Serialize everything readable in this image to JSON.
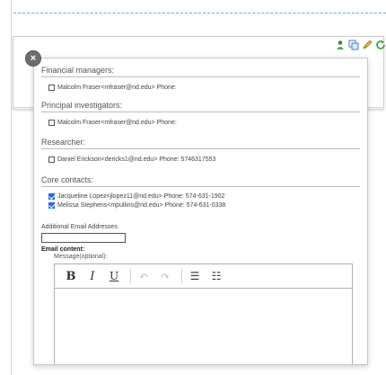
{
  "toolbar_icons": [
    "person-icon",
    "copy-icon",
    "pen-icon",
    "refresh-icon"
  ],
  "dialog": {
    "close_label": "×",
    "sections": {
      "financial": {
        "heading": "Financial managers:",
        "contacts": [
          {
            "text": "Malcolm Fraser<mfraser@nd.edu> Phone:",
            "checked": false
          }
        ]
      },
      "principal": {
        "heading": "Principal investigators:",
        "contacts": [
          {
            "text": "Malcolm Fraser<mfraser@nd.edu> Phone:",
            "checked": false
          }
        ]
      },
      "researcher": {
        "heading": "Researcher:",
        "contacts": [
          {
            "text": "Daniel Erickson<dericks1@nd.edu> Phone: 5746317553",
            "checked": false
          }
        ]
      },
      "core": {
        "heading": "Core contacts:",
        "contacts": [
          {
            "text": "Jacqueline Lopez<jlopez11@nd.edu> Phone: 574-631-1902",
            "checked": true
          },
          {
            "text": "Melissa Stephens<mpullins@nd.edu> Phone: 574-631-0338",
            "checked": true
          }
        ]
      }
    },
    "additional_emails_label": "Additional Email Addresses",
    "additional_emails_value": "",
    "email_content_label": "Email content:",
    "message_label": "Message(optional):",
    "editor_toolbar": {
      "bold": "B",
      "italic": "I",
      "underline": "U",
      "undo": "↶",
      "redo": "↷",
      "bullet_list": "☰",
      "numbered_list": "☷"
    },
    "accent_color": "#2d6bd6"
  }
}
